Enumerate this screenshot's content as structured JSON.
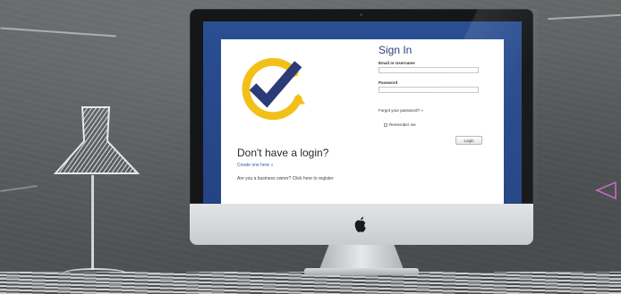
{
  "login": {
    "signin_title": "Sign In",
    "email_label": "Email or Username",
    "email_value": "",
    "password_label": "Password",
    "password_value": "",
    "forgot_link": "Forgot your password? »",
    "remember_label": "Remember me",
    "login_button": "Login",
    "no_login_title": "Don't have a login?",
    "create_link": "Create one here »",
    "business_note": "Are you a business owner? Click here to register"
  },
  "icons": {
    "logo": "check-badge-icon",
    "device": "apple-logo-icon"
  },
  "colors": {
    "screen_bg": "#2a4e92",
    "check_mark": "#2d3a78",
    "logo_ring": "#f2c018",
    "title": "#2d3f7d"
  }
}
